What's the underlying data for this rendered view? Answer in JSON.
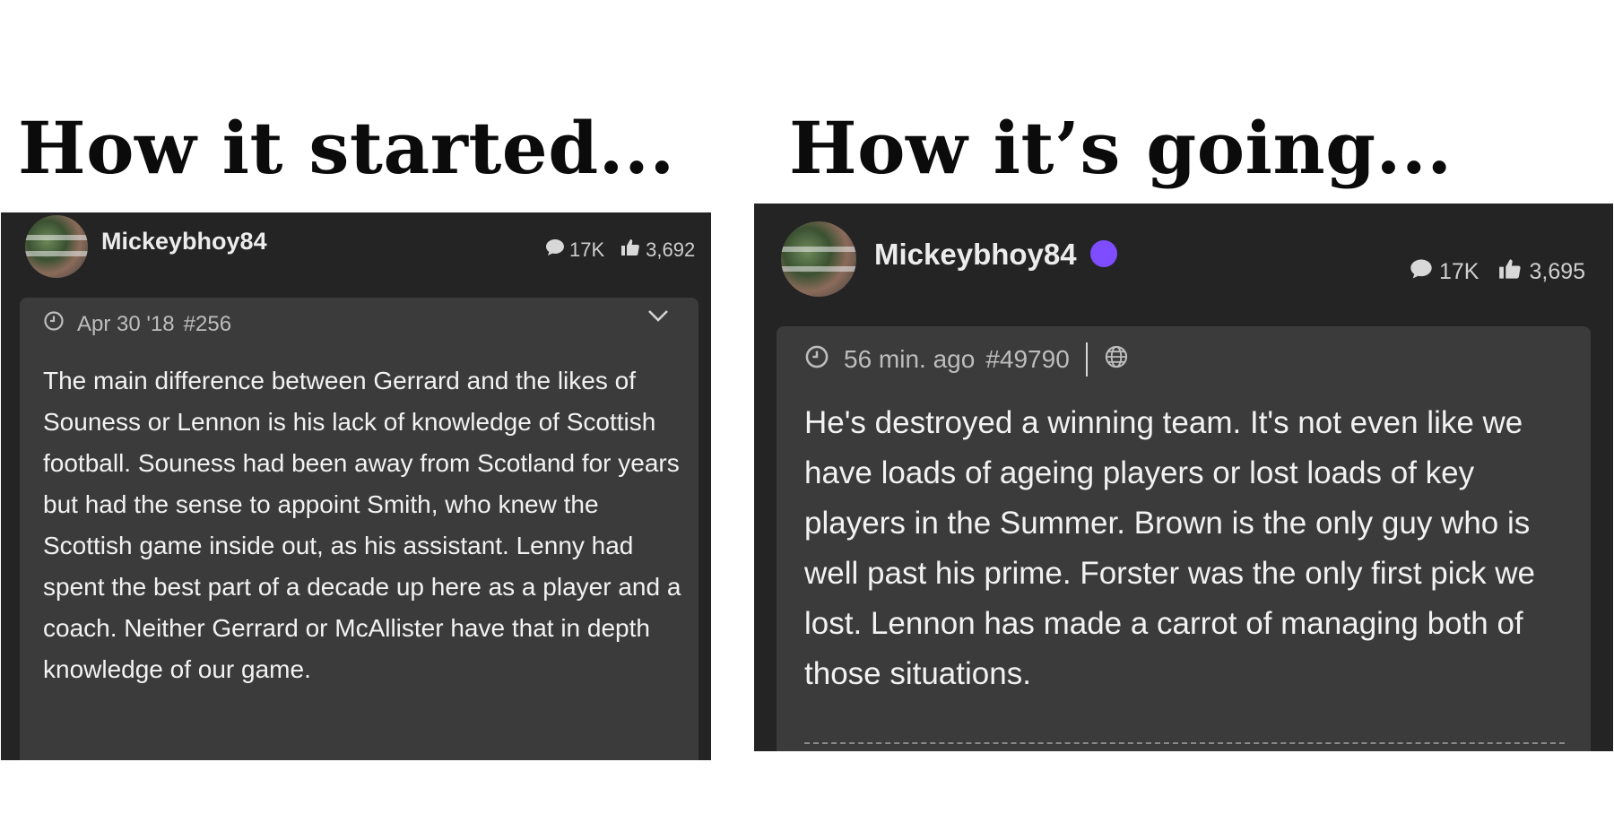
{
  "left": {
    "heading": "How it started...",
    "post": {
      "username": "Mickeybhoy84",
      "comments": "17K",
      "likes": "3,692",
      "date": "Apr 30 '18",
      "post_number": "#256",
      "body": "The main difference between Gerrard and the likes of Souness or Lennon is his lack of knowledge of Scottish football. Souness had been away from Scotland for years but had the sense to appoint Smith, who knew the Scottish game inside out, as his assistant. Lenny had spent the best part of a decade up here as a player and a coach. Neither Gerrard or McAllister have that in depth knowledge of our game."
    }
  },
  "right": {
    "heading": "How it’s going...",
    "post": {
      "username": "Mickeybhoy84",
      "comments": "17K",
      "likes": "3,695",
      "date": "56 min. ago",
      "post_number": "#49790",
      "body": "He's destroyed a winning team. It's not even like we have loads of ageing players or lost loads of key players in the Summer. Brown is the only guy who is well past his prime. Forster was the only first pick we lost. Lennon has made a carrot of managing both of those situations."
    }
  },
  "icons": {
    "comment": "comment-bubble-icon",
    "like": "thumbs-up-icon",
    "clock": "clock-icon",
    "globe": "globe-icon",
    "expand": "chevron-down-icon"
  },
  "colors": {
    "panel_bg": "#242424",
    "card_bg": "#3b3b3b",
    "badge": "#7d4dff"
  }
}
